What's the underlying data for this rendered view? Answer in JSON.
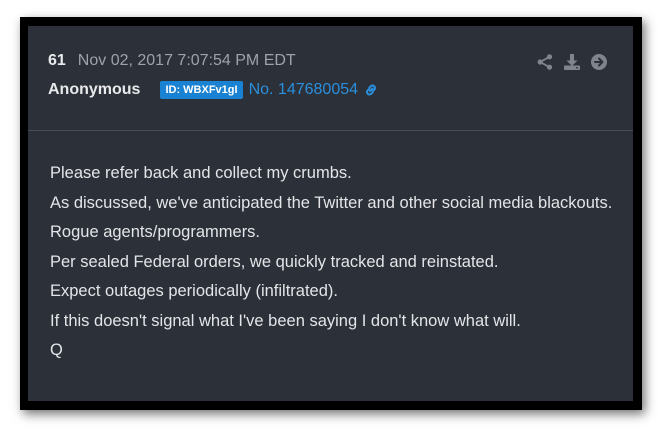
{
  "post": {
    "number": "61",
    "date": "Nov 02, 2017 7:07:54 PM EDT",
    "author": "Anonymous",
    "id_badge": "ID: WBXFv1gI",
    "post_link": "No. 147680054",
    "lines": [
      "Please refer back and collect my crumbs.",
      "As discussed, we've anticipated the Twitter and other social media blackouts.",
      "Rogue agents/programmers.",
      "Per sealed Federal orders, we quickly tracked and reinstated.",
      "Expect outages periodically (infiltrated).",
      "If this doesn't signal what I've been saying I don't know what will.",
      "Q"
    ]
  },
  "actions": {
    "icons": [
      "share-icon",
      "download-icon",
      "arrow-right-circle-icon"
    ]
  },
  "colors": {
    "card_background": "#2c3038",
    "text_primary": "#e9eaec",
    "text_muted": "#9ea2a9",
    "accent": "#2a8fdd",
    "badge": "#1a82d2"
  }
}
